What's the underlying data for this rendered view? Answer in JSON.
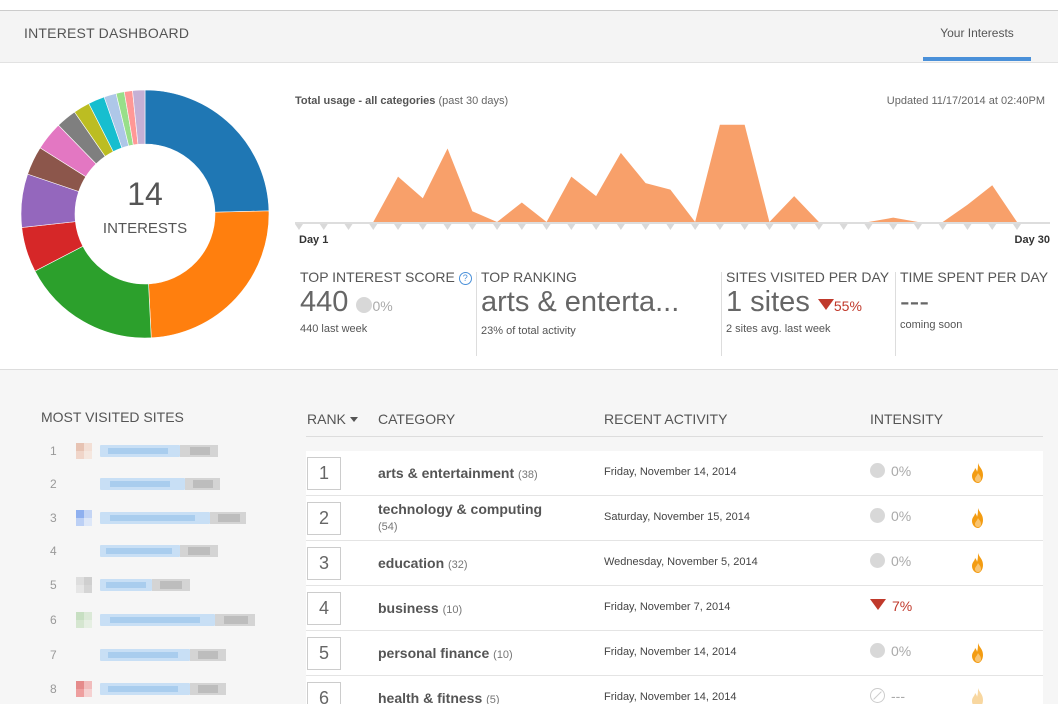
{
  "header": {
    "title": "INTEREST DASHBOARD",
    "tab_label": "Your Interests",
    "accent_color": "#4a90d9"
  },
  "donut": {
    "count": "14",
    "label": "INTERESTS",
    "slices": [
      {
        "value": 23,
        "color": "#1f77b4"
      },
      {
        "value": 23,
        "color": "#ff7f0e"
      },
      {
        "value": 17,
        "color": "#2ca02c"
      },
      {
        "value": 5.5,
        "color": "#d62728"
      },
      {
        "value": 6.5,
        "color": "#9467bd"
      },
      {
        "value": 3.5,
        "color": "#8c564b"
      },
      {
        "value": 3.5,
        "color": "#e377c2"
      },
      {
        "value": 2.5,
        "color": "#7f7f7f"
      },
      {
        "value": 2,
        "color": "#bcbd22"
      },
      {
        "value": 2,
        "color": "#17becf"
      },
      {
        "value": 1.5,
        "color": "#aec7e8"
      },
      {
        "value": 1,
        "color": "#98df8a"
      },
      {
        "value": 1,
        "color": "#ff9896"
      },
      {
        "value": 1.5,
        "color": "#c5b0d5"
      }
    ]
  },
  "usage": {
    "title_bold": "Total usage - all categories",
    "title_rest": " (past 30 days)",
    "updated": "Updated 11/17/2014 at 02:40PM",
    "day_start": "Day 1",
    "day_end": "Day 30",
    "fill_color": "#f8a06a"
  },
  "chart_data": {
    "type": "area",
    "x": [
      1,
      2,
      3,
      4,
      5,
      6,
      7,
      8,
      9,
      10,
      11,
      12,
      13,
      14,
      15,
      16,
      17,
      18,
      19,
      20,
      21,
      22,
      23,
      24,
      25,
      26,
      27,
      28,
      29,
      30
    ],
    "values": [
      0,
      0,
      0,
      0,
      42,
      22,
      68,
      10,
      0,
      18,
      0,
      42,
      24,
      64,
      36,
      30,
      0,
      90,
      90,
      0,
      24,
      0,
      0,
      0,
      4,
      0,
      0,
      16,
      34,
      0
    ],
    "ylim": [
      0,
      100
    ],
    "title": "",
    "xlabel": "",
    "ylabel": ""
  },
  "stats": [
    {
      "label": "TOP INTEREST SCORE",
      "value": "440",
      "change": "0%",
      "sub": "440 last week"
    },
    {
      "label": "TOP RANKING",
      "value": "arts & enterta...",
      "sub": "23% of total activity"
    },
    {
      "label": "SITES VISITED PER DAY",
      "value": "1 sites",
      "change": "55%",
      "sub": "2 sites avg. last week"
    },
    {
      "label": "TIME SPENT PER DAY",
      "value": "---",
      "sub": "coming soon"
    }
  ],
  "most_visited": {
    "title": "MOST VISITED SITES",
    "ranks": [
      "1",
      "2",
      "3",
      "4",
      "5",
      "6",
      "7",
      "8"
    ]
  },
  "table": {
    "headers": {
      "rank": "RANK",
      "category": "CATEGORY",
      "activity": "RECENT ACTIVITY",
      "intensity": "INTENSITY"
    },
    "rows": [
      {
        "rank": "1",
        "name": "arts & entertainment",
        "count": "(38)",
        "date": "Friday, November 14, 2014",
        "intensity": "0%"
      },
      {
        "rank": "2",
        "name": "technology & computing",
        "count": "(54)",
        "date": "Saturday, November 15, 2014",
        "intensity": "0%"
      },
      {
        "rank": "3",
        "name": "education",
        "count": "(32)",
        "date": "Wednesday, November 5, 2014",
        "intensity": "0%"
      },
      {
        "rank": "4",
        "name": "business",
        "count": "(10)",
        "date": "Friday, November 7, 2014",
        "intensity": "7%"
      },
      {
        "rank": "5",
        "name": "personal finance",
        "count": "(10)",
        "date": "Friday, November 14, 2014",
        "intensity": "0%"
      },
      {
        "rank": "6",
        "name": "health & fitness",
        "count": "(5)",
        "date": "Friday, November 14, 2014",
        "intensity": "---"
      }
    ]
  }
}
